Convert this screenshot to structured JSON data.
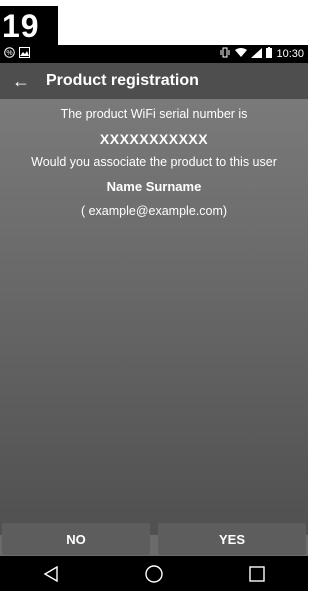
{
  "step": "19",
  "statusbar": {
    "time": "10:30"
  },
  "appbar": {
    "title": "Product registration"
  },
  "dialog": {
    "line1": "The product WiFi serial number is",
    "serial": "XXXXXXXXXXX",
    "line2": "Would you associate the product to this user",
    "user_name": "Name Surname",
    "user_email": "( example@example.com)"
  },
  "buttons": {
    "no": "NO",
    "yes": "YES"
  },
  "icons": {
    "back": "arrow-left-icon",
    "status_left": [
      "percent-icon",
      "image-icon"
    ],
    "status_right": [
      "vibrate-icon",
      "wifi-icon",
      "signal-icon",
      "battery-icon"
    ],
    "nav": [
      "back-triangle-icon",
      "home-circle-icon",
      "recents-square-icon"
    ]
  }
}
